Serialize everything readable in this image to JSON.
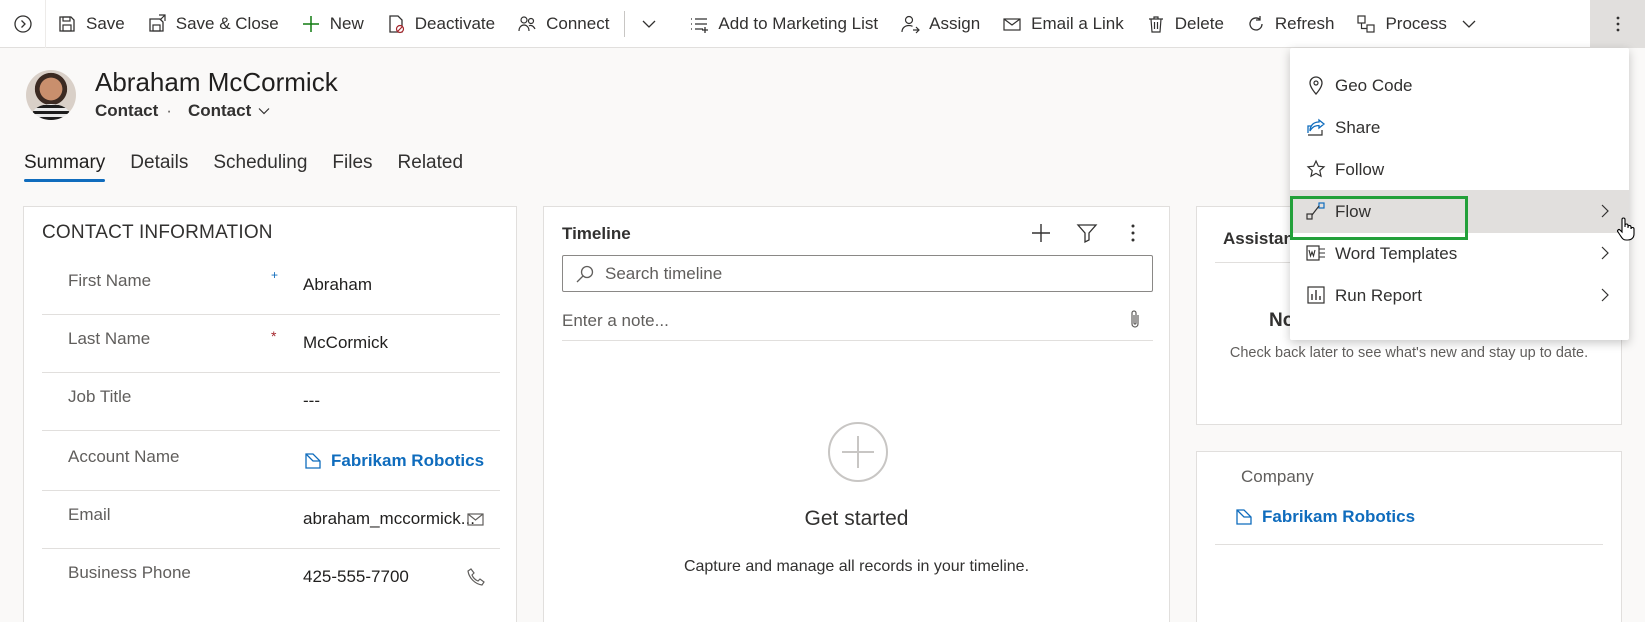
{
  "commandbar": {
    "nav_icon": "chevron-circle-right-icon",
    "save": "Save",
    "save_close": "Save & Close",
    "new": "New",
    "deactivate": "Deactivate",
    "connect": "Connect",
    "add_marketing": "Add to Marketing List",
    "assign": "Assign",
    "email_link": "Email a Link",
    "delete": "Delete",
    "refresh": "Refresh",
    "process": "Process"
  },
  "record": {
    "name": "Abraham McCormick",
    "entity": "Contact",
    "separator": "·",
    "form": "Contact"
  },
  "tabs": [
    "Summary",
    "Details",
    "Scheduling",
    "Files",
    "Related"
  ],
  "contact_info": {
    "title": "CONTACT INFORMATION",
    "fields": [
      {
        "label": "First Name",
        "req": "+",
        "value": "Abraham"
      },
      {
        "label": "Last Name",
        "req": "*",
        "value": "McCormick"
      },
      {
        "label": "Job Title",
        "req": "",
        "value": "---"
      },
      {
        "label": "Account Name",
        "req": "",
        "value": "Fabrikam Robotics"
      },
      {
        "label": "Email",
        "req": "",
        "value": "abraham_mccormick..."
      },
      {
        "label": "Business Phone",
        "req": "",
        "value": "425-555-7700"
      }
    ]
  },
  "timeline": {
    "title": "Timeline",
    "search_placeholder": "Search timeline",
    "note_placeholder": "Enter a note...",
    "empty_title": "Get started",
    "empty_sub": "Capture and manage all records in your timeline."
  },
  "assistant": {
    "title": "Assistan",
    "heading": "No",
    "sub": "Check back later to see what's new and stay up to date."
  },
  "company": {
    "label": "Company",
    "value": "Fabrikam Robotics"
  },
  "menu": {
    "items": [
      "Geo Code",
      "Share",
      "Follow",
      "Flow",
      "Word Templates",
      "Run Report"
    ]
  },
  "colors": {
    "accent": "#0f6cbd",
    "highlight": "#23a03a",
    "required": "#a4262c"
  }
}
